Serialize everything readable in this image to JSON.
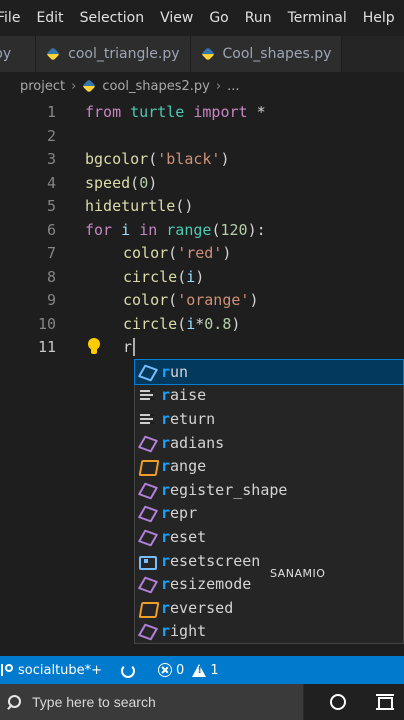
{
  "menu": [
    "File",
    "Edit",
    "Selection",
    "View",
    "Go",
    "Run",
    "Terminal",
    "Help"
  ],
  "tabs": [
    {
      "label": "py"
    },
    {
      "label": "cool_triangle.py"
    },
    {
      "label": "Cool_shapes.py"
    }
  ],
  "breadcrumb": {
    "folder": "project",
    "file": "cool_shapes2.py",
    "more": "..."
  },
  "editor": {
    "line_numbers": [
      "1",
      "2",
      "3",
      "4",
      "5",
      "6",
      "7",
      "8",
      "9",
      "10",
      "11"
    ],
    "lines": {
      "l1": {
        "from": "from",
        "module": "turtle",
        "import": "import",
        "star": "*"
      },
      "l3": {
        "fn": "bgcolor",
        "open": "(",
        "arg": "'black'",
        "close": ")"
      },
      "l4": {
        "fn": "speed",
        "open": "(",
        "arg": "0",
        "close": ")"
      },
      "l5": {
        "fn": "hideturtle",
        "parens": "()"
      },
      "l6": {
        "for": "for",
        "var": "i",
        "in": "in",
        "fn": "range",
        "open": "(",
        "arg": "120",
        "close": "):"
      },
      "l7": {
        "fn": "color",
        "open": "(",
        "arg": "'red'",
        "close": ")"
      },
      "l8": {
        "fn": "circle",
        "open": "(",
        "arg": "i",
        "close": ")"
      },
      "l9": {
        "fn": "color",
        "open": "(",
        "arg": "'orange'",
        "close": ")"
      },
      "l10": {
        "fn": "circle",
        "open": "(",
        "arg": "i",
        "op": "*",
        "num": "0.8",
        "close": ")"
      },
      "l11": {
        "typed": "r"
      }
    }
  },
  "suggestions": [
    {
      "match": "r",
      "rest": "un",
      "icon": "cube-icon"
    },
    {
      "match": "r",
      "rest": "aise",
      "icon": "keyword-icon"
    },
    {
      "match": "r",
      "rest": "eturn",
      "icon": "keyword-icon"
    },
    {
      "match": "r",
      "rest": "adians",
      "icon": "method-icon"
    },
    {
      "match": "r",
      "rest": "ange",
      "icon": "class-icon"
    },
    {
      "match": "r",
      "rest": "egister_shape",
      "icon": "method-icon"
    },
    {
      "match": "r",
      "rest": "epr",
      "icon": "method-icon"
    },
    {
      "match": "r",
      "rest": "eset",
      "icon": "method-icon"
    },
    {
      "match": "r",
      "rest": "esetscreen",
      "icon": "variable-icon"
    },
    {
      "match": "r",
      "rest": "esizemode",
      "icon": "method-icon"
    },
    {
      "match": "r",
      "rest": "eversed",
      "icon": "class-icon"
    },
    {
      "match": "r",
      "rest": "ight",
      "icon": "method-icon"
    }
  ],
  "watermark": "SANAMIO",
  "status": {
    "remote": "socialtube*+",
    "errors": "0",
    "warnings": "1"
  },
  "taskbar": {
    "search_placeholder": "Type here to search"
  },
  "colors": {
    "statusbar": "#007acc",
    "keyword": "#569cd6",
    "function": "#dcdcaa",
    "string": "#ce9178",
    "number": "#b5cea8",
    "match_highlight": "#18a3ff"
  }
}
